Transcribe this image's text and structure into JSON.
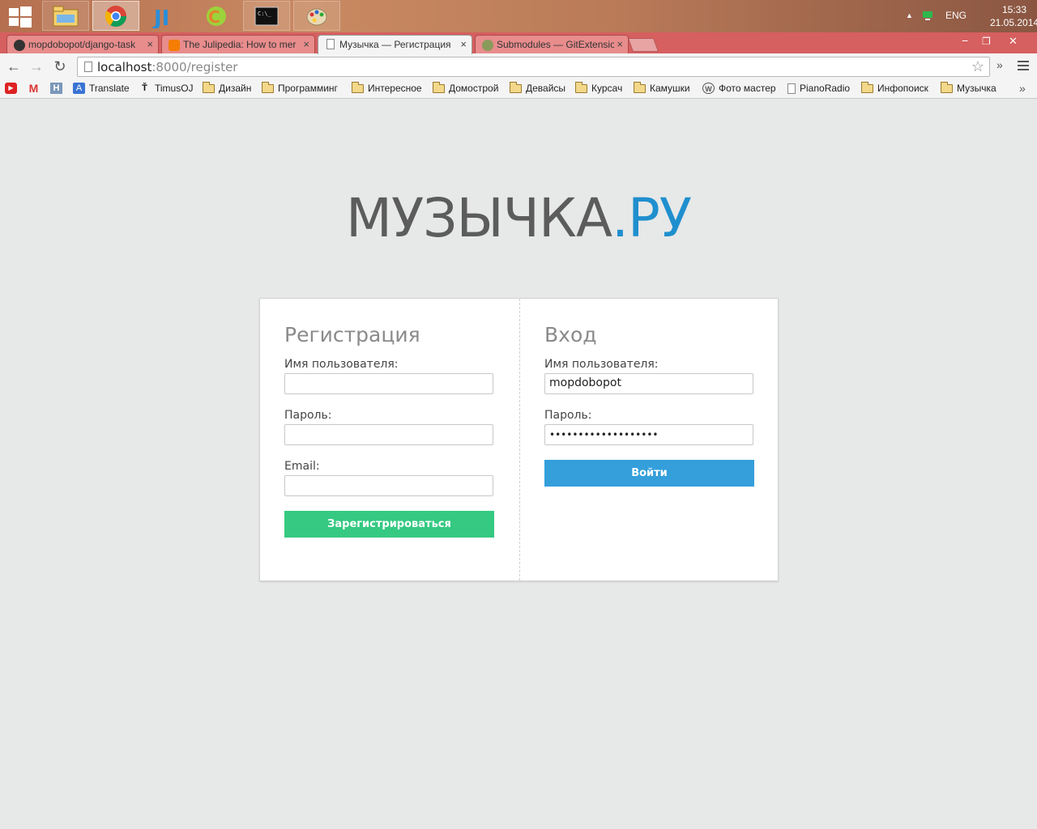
{
  "taskbar": {
    "tray": {
      "lang": "ENG",
      "time": "15:33",
      "date": "21.05.2014",
      "expand_arrow": "▲"
    }
  },
  "tabs": [
    {
      "title": "mopdobopot/django-task",
      "close": "×",
      "favicon_color": "#333333"
    },
    {
      "title": "The Julipedia: How to mer",
      "close": "×",
      "favicon_color": "#f57d00"
    },
    {
      "title": "Музычка — Регистрация",
      "close": "×",
      "favicon_color": "#ffffff"
    },
    {
      "title": "Submodules — GitExtensio",
      "close": "×",
      "favicon_color": "#8a9a5b"
    }
  ],
  "window_controls": {
    "minimize": "−",
    "restore": "❐",
    "close": "✕"
  },
  "toolbar": {
    "back": "←",
    "forward": "→",
    "reload": "↻",
    "url_host": "localhost",
    "url_rest": ":8000/register",
    "star": "☆",
    "more": "»"
  },
  "bookmarks": [
    {
      "label": "",
      "icon": "youtube-icon"
    },
    {
      "label": "",
      "icon": "gmail-icon"
    },
    {
      "label": "",
      "icon": "habr-icon"
    },
    {
      "label": "Translate",
      "icon": "translate-icon"
    },
    {
      "label": "TimusOJ",
      "icon": "timus-icon"
    },
    {
      "label": "Дизайн",
      "icon": "folder-icon"
    },
    {
      "label": "Программинг",
      "icon": "folder-icon"
    },
    {
      "label": "Интересное",
      "icon": "folder-icon"
    },
    {
      "label": "Домострой",
      "icon": "folder-icon"
    },
    {
      "label": "Девайсы",
      "icon": "folder-icon"
    },
    {
      "label": "Курсач",
      "icon": "folder-icon"
    },
    {
      "label": "Камушки",
      "icon": "folder-icon"
    },
    {
      "label": "Фото мастер",
      "icon": "wordpress-icon"
    },
    {
      "label": "PianoRadio",
      "icon": "page-icon"
    },
    {
      "label": "Инфопоиск",
      "icon": "folder-icon"
    },
    {
      "label": "Музычка",
      "icon": "folder-icon"
    }
  ],
  "bookmarks_more": "»",
  "logo": {
    "main": "МУЗЫЧКА",
    "accent": ".РУ"
  },
  "register": {
    "title": "Регистрация",
    "username_label": "Имя пользователя:",
    "username_value": "",
    "password_label": "Пароль:",
    "password_value": "",
    "email_label": "Email:",
    "email_value": "",
    "submit": "Зарегистрироваться"
  },
  "login": {
    "title": "Вход",
    "username_label": "Имя пользователя:",
    "username_value": "mopdobopot",
    "password_label": "Пароль:",
    "password_value": "•••••••••••••••••••",
    "submit": "Войти"
  },
  "colors": {
    "brand_gray": "#5c5c5c",
    "brand_blue": "#1f8fce",
    "register_button": "#35c982",
    "login_button": "#349fdb"
  }
}
